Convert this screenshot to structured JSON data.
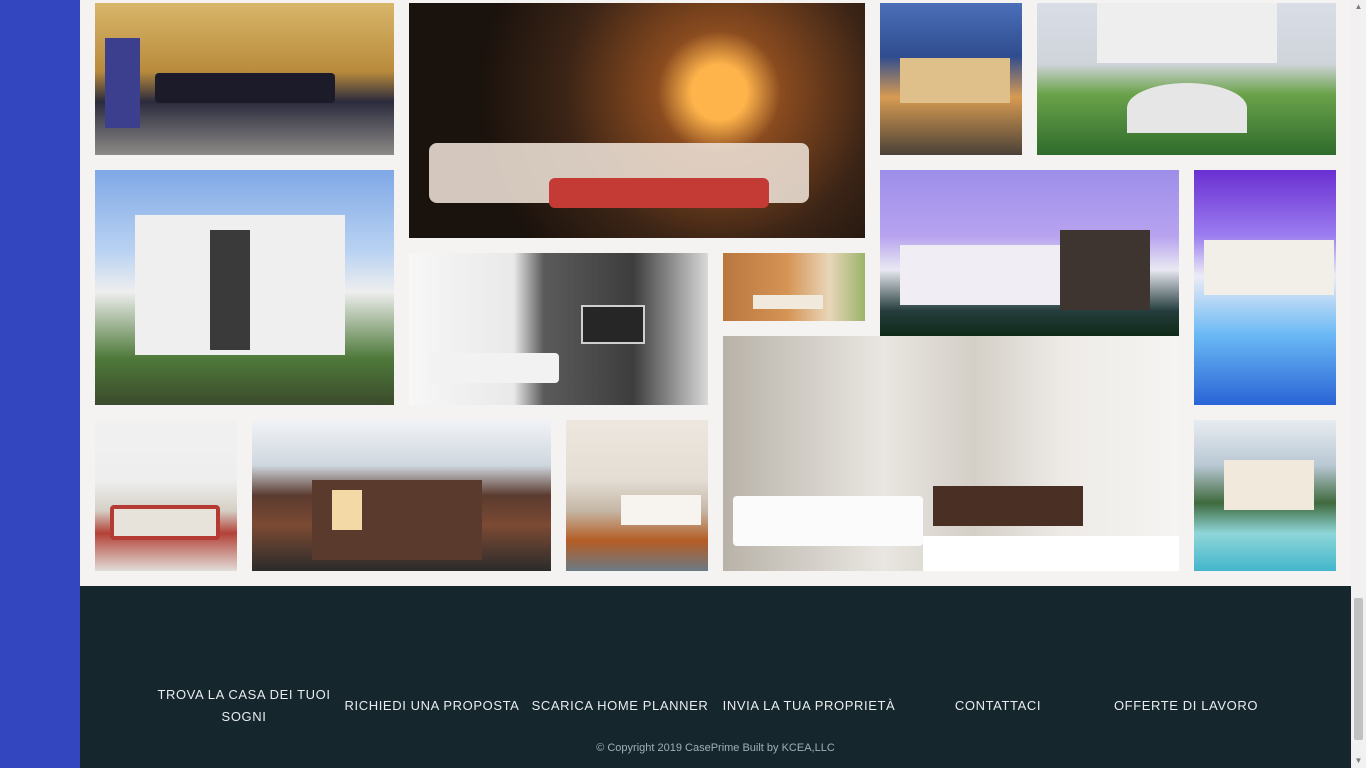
{
  "gallery": {
    "images": [
      {
        "alt": "kitchen"
      },
      {
        "alt": "living room with fireplace"
      },
      {
        "alt": "villa at dusk"
      },
      {
        "alt": "terraced garden mansion"
      },
      {
        "alt": "modern white house"
      },
      {
        "alt": "tv room"
      },
      {
        "alt": "wood room"
      },
      {
        "alt": "modern house at twilight"
      },
      {
        "alt": "pool mansion"
      },
      {
        "alt": "bathroom with bed"
      },
      {
        "alt": "sunken living room"
      },
      {
        "alt": "wood modern house"
      },
      {
        "alt": "bedroom"
      },
      {
        "alt": "lake villa with pool"
      }
    ]
  },
  "footer": {
    "nav": [
      {
        "label": "TROVA LA CASA DEI TUOI SOGNI"
      },
      {
        "label": "RICHIEDI UNA PROPOSTA"
      },
      {
        "label": "SCARICA HOME PLANNER"
      },
      {
        "label": "INVIA LA TUA PROPRIETÀ"
      },
      {
        "label": "CONTATTACI"
      },
      {
        "label": "OFFERTE DI LAVORO"
      }
    ],
    "copyright": "© Copyright 2019 CasePrime Built by KCEA,LLC"
  },
  "colors": {
    "sidebar": "#3346bf",
    "footer_bg": "#15262d",
    "gallery_bg": "#f5f3f2"
  },
  "scrollbar": {
    "up_icon": "▲",
    "down_icon": "▼"
  }
}
